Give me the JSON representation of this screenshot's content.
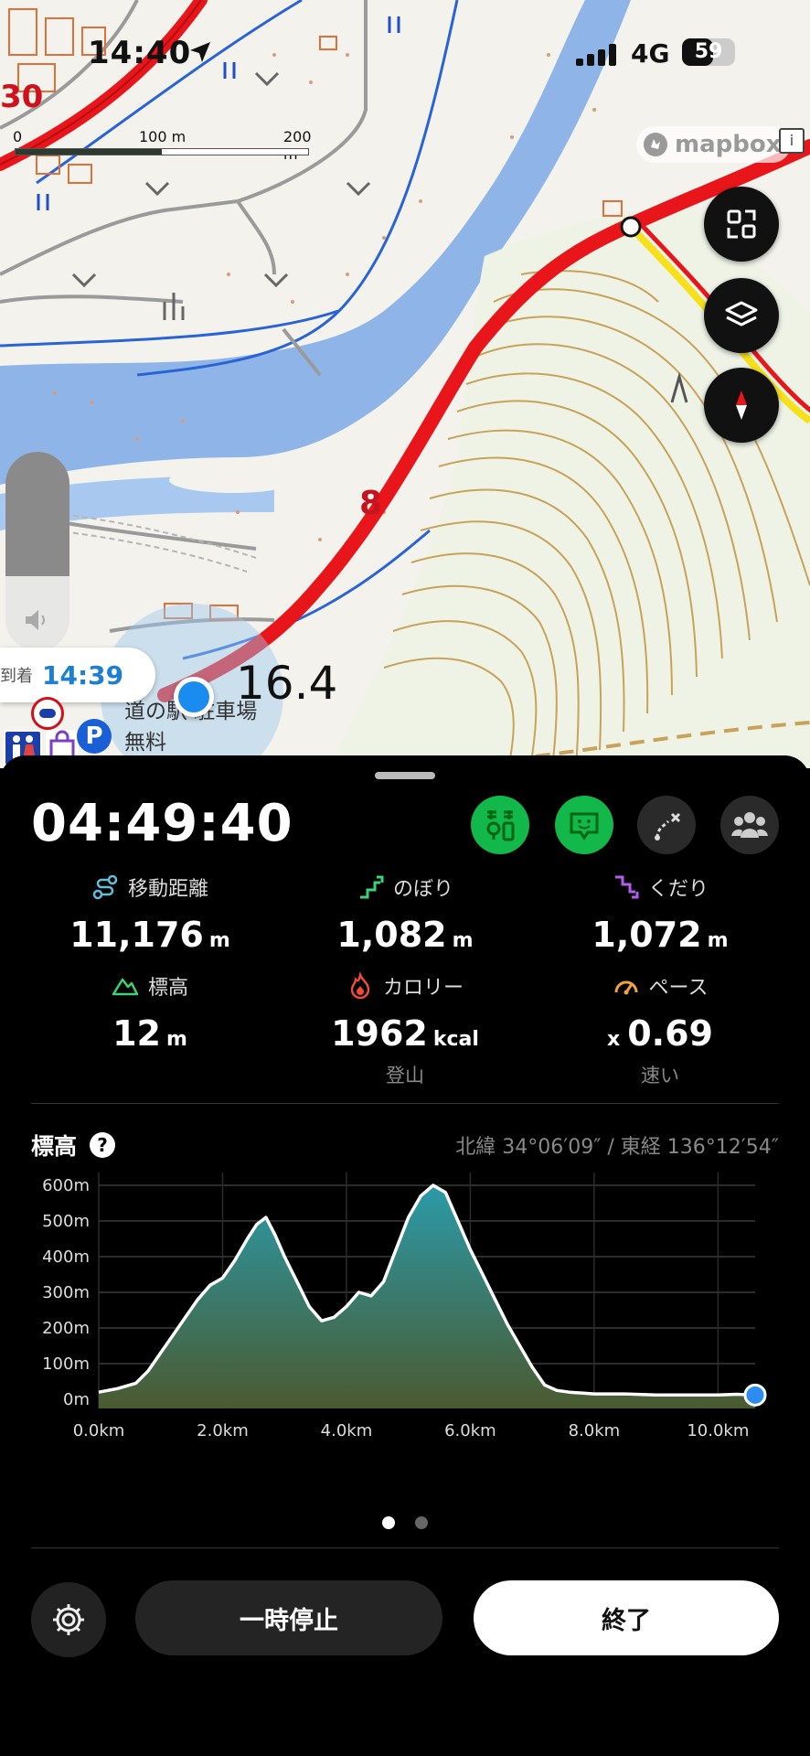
{
  "status_bar": {
    "time": "14:40",
    "network": "4G",
    "battery": "59",
    "battery_level": 0.59
  },
  "map": {
    "scale_labels": [
      "0",
      "100 m",
      "200 m"
    ],
    "attribution": "mapbox",
    "labels": {
      "contour_8": "8",
      "route_marker": "30",
      "elevation_point": "16.4",
      "poi_name": "道の駅 駐車場",
      "poi_sub": "無料"
    },
    "arrival": {
      "label": "到着",
      "time": "14:39"
    },
    "route_color": "#e8151b",
    "water_color": "#8fb5e8",
    "contour_color": "#c9a25a"
  },
  "sheet": {
    "elapsed": "04:49:40",
    "stats": [
      {
        "label": "移動距離",
        "value": "11,176",
        "unit": "m",
        "icon": "distance-icon",
        "color": "#5fc0d8"
      },
      {
        "label": "のぼり",
        "value": "1,082",
        "unit": "m",
        "icon": "ascent-icon",
        "color": "#3dd17a"
      },
      {
        "label": "くだり",
        "value": "1,072",
        "unit": "m",
        "icon": "descent-icon",
        "color": "#b45cf0"
      },
      {
        "label": "標高",
        "value": "12",
        "unit": "m",
        "icon": "mountain-icon",
        "color": "#3dd17a"
      },
      {
        "label": "カロリー",
        "value": "1962",
        "unit": "kcal",
        "icon": "flame-icon",
        "color": "#f04a3a",
        "sub": "登山"
      },
      {
        "label": "ペース",
        "value": "0.69",
        "prefix": "x",
        "icon": "speedometer-icon",
        "color": "#f2a23a",
        "sub": "速い"
      }
    ],
    "elevation": {
      "title": "標高",
      "coords": "北緯 34°06′09″ / 東経 136°12′54″"
    },
    "buttons": {
      "pause": "一時停止",
      "end": "終了"
    }
  },
  "chart_data": {
    "type": "area",
    "title": "標高",
    "xlabel": "",
    "ylabel": "",
    "x_ticks": [
      "0.0km",
      "2.0km",
      "4.0km",
      "6.0km",
      "8.0km",
      "10.0km"
    ],
    "y_ticks": [
      "0m",
      "100m",
      "200m",
      "300m",
      "400m",
      "500m",
      "600m"
    ],
    "xlim": [
      0,
      10.6
    ],
    "ylim": [
      0,
      600
    ],
    "x": [
      0,
      0.3,
      0.6,
      0.8,
      1.0,
      1.2,
      1.4,
      1.6,
      1.8,
      2.0,
      2.2,
      2.4,
      2.55,
      2.7,
      2.85,
      3.0,
      3.2,
      3.4,
      3.6,
      3.8,
      4.0,
      4.2,
      4.4,
      4.6,
      4.8,
      5.0,
      5.2,
      5.4,
      5.6,
      5.8,
      6.0,
      6.2,
      6.4,
      6.6,
      6.8,
      7.0,
      7.2,
      7.4,
      7.6,
      8.0,
      8.5,
      9.0,
      9.5,
      10.0,
      10.3,
      10.6
    ],
    "y": [
      20,
      30,
      45,
      80,
      130,
      180,
      230,
      280,
      320,
      340,
      390,
      450,
      490,
      510,
      460,
      400,
      330,
      260,
      220,
      230,
      260,
      300,
      290,
      330,
      420,
      510,
      570,
      600,
      580,
      500,
      420,
      350,
      280,
      210,
      150,
      90,
      40,
      25,
      20,
      15,
      15,
      12,
      12,
      12,
      14,
      12
    ],
    "line_color": "#ffffff",
    "fill_top_color": "#2b9aa8",
    "fill_bottom_color": "#4a5a30",
    "marker_color": "#2d8cf0",
    "grid": true,
    "page_count": 2,
    "current_page": 1
  }
}
